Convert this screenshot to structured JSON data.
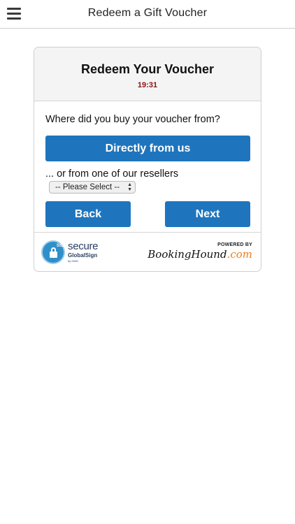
{
  "header": {
    "title": "Redeem a Gift Voucher",
    "menu_icon": "hamburger-menu-icon"
  },
  "card": {
    "title": "Redeem Your Voucher",
    "timer": "19:31",
    "question": "Where did you buy your voucher from?",
    "direct_button": "Directly from us",
    "resellers_label": "... or from one of our resellers",
    "reseller_select": {
      "selected": "-- Please Select --"
    },
    "back_button": "Back",
    "next_button": "Next"
  },
  "footer": {
    "ssl_badge": {
      "corner_label": "SSL",
      "word": "secure",
      "issuer": "GlobalSign",
      "by": "by GMO",
      "icon": "lock-icon"
    },
    "powered_by": "POWERED BY",
    "brand_name": "BookingHound",
    "brand_suffix": ".com"
  },
  "colors": {
    "primary_button": "#1f75bd",
    "timer": "#8b1010",
    "brand_suffix": "#f07d1a",
    "card_header_bg": "#f4f4f4"
  }
}
